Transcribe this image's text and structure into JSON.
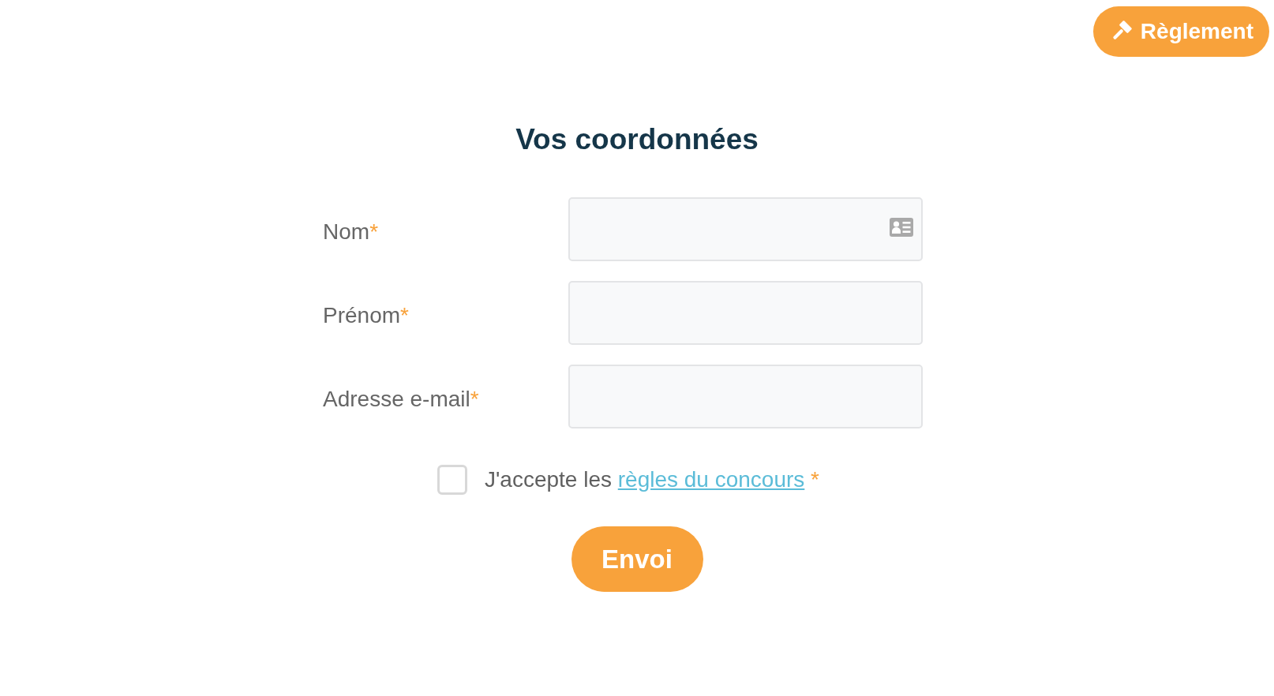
{
  "rules_button": {
    "label": "Règlement"
  },
  "title": "Vos coordonnées",
  "fields": [
    {
      "label": "Nom",
      "required_mark": "*",
      "autofill": true
    },
    {
      "label": "Prénom",
      "required_mark": "*",
      "autofill": false
    },
    {
      "label": "Adresse e-mail",
      "required_mark": "*",
      "autofill": false
    }
  ],
  "consent": {
    "checked": false,
    "text": "J'accepte les",
    "link": "règles du concours",
    "required_mark": "*"
  },
  "submit": {
    "label": "Envoi"
  }
}
